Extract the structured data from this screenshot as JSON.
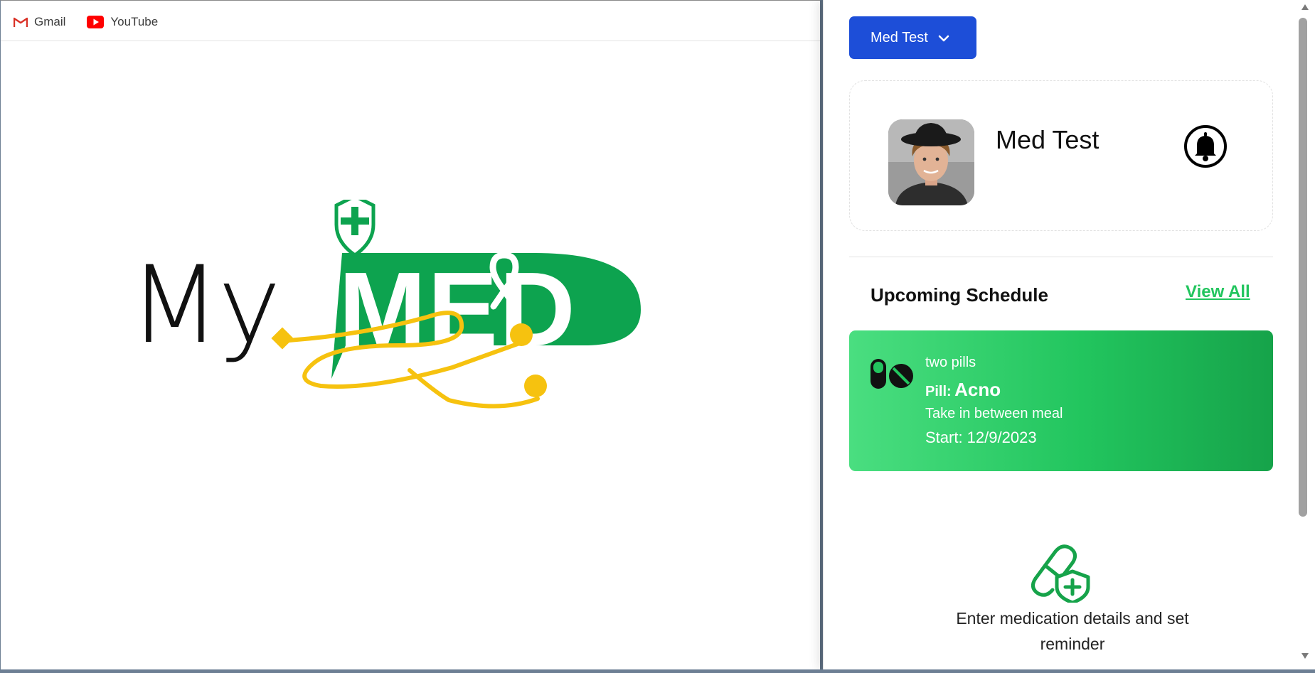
{
  "bookmarks": [
    {
      "label": "Gmail",
      "icon": "gmail-icon"
    },
    {
      "label": "YouTube",
      "icon": "youtube-icon"
    }
  ],
  "logo": {
    "word_my": "My",
    "word_med": "MED",
    "icons": [
      "shield-plus-icon",
      "ribbon-icon",
      "stethoscope-icon"
    ]
  },
  "panel": {
    "profile_select": "Med Test",
    "profile_name": "Med Test",
    "schedule_title": "Upcoming Schedule",
    "view_all": "View All",
    "schedule_item": {
      "dose": "two pills",
      "pill_label": "Pill:",
      "pill_name": "Acno",
      "instruction": "Take in between meal",
      "start": "Start: 12/9/2023"
    },
    "add_prompt": "Enter medication details and set reminder"
  },
  "colors": {
    "primary_blue": "#1d4ed8",
    "accent_green": "#22c55e",
    "logo_green": "#0da34f",
    "stethoscope_yellow": "#f6c20f"
  }
}
